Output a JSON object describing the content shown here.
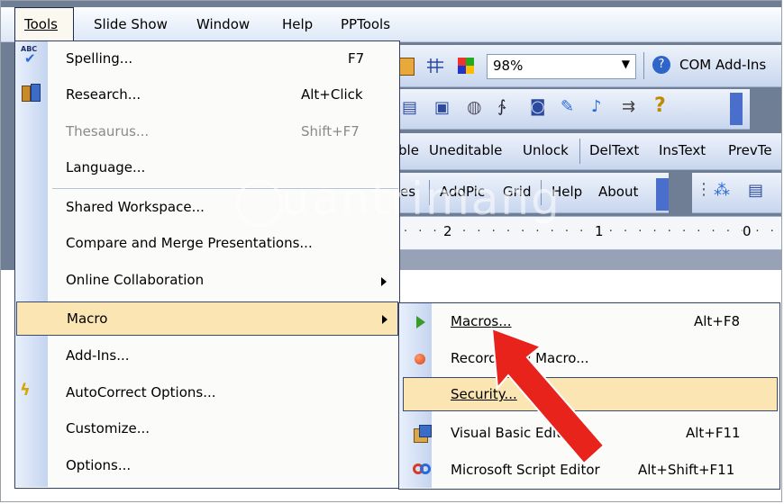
{
  "menubar": {
    "items": [
      {
        "label": "Tools"
      },
      {
        "label": "Slide Show"
      },
      {
        "label": "Window"
      },
      {
        "label": "Help"
      },
      {
        "label": "PPTools"
      }
    ]
  },
  "toolbar1": {
    "zoom": "98%",
    "com_addins": "COM Add-Ins"
  },
  "toolbar3": {
    "items": [
      "ble",
      "Uneditable",
      "Unlock",
      "DelText",
      "InsText",
      "PrevTe"
    ]
  },
  "toolbar4": {
    "items": [
      "es",
      "AddPic",
      "Grid",
      "Help",
      "About"
    ]
  },
  "ruler": {
    "marks": [
      "2",
      "1",
      "0"
    ]
  },
  "watermark": "uantrimang",
  "tools_menu": {
    "items": [
      {
        "label": "Spelling...",
        "shortcut": "F7",
        "icon": "spelling-abc-icon"
      },
      {
        "label": "Research...",
        "shortcut": "Alt+Click",
        "icon": "research-icon"
      },
      {
        "label": "Thesaurus...",
        "shortcut": "Shift+F7",
        "disabled": true
      },
      {
        "label": "Language..."
      },
      {
        "label": "Shared Workspace..."
      },
      {
        "label": "Compare and Merge Presentations..."
      },
      {
        "label": "Online Collaboration",
        "submenu": true
      },
      {
        "label": "Macro",
        "submenu": true,
        "highlighted": true
      },
      {
        "label": "Add-Ins..."
      },
      {
        "label": "AutoCorrect Options...",
        "icon": "lightning-icon"
      },
      {
        "label": "Customize..."
      },
      {
        "label": "Options..."
      }
    ]
  },
  "macro_submenu": {
    "items": [
      {
        "label": "Macros...",
        "shortcut": "Alt+F8",
        "icon": "play-triangle-icon"
      },
      {
        "label": "Record New Macro...",
        "icon": "record-dot-icon"
      },
      {
        "label": "Security...",
        "highlighted": true
      },
      {
        "label": "Visual Basic Editor",
        "shortcut": "Alt+F11",
        "icon": "vb-editor-icon"
      },
      {
        "label": "Microsoft Script Editor",
        "shortcut": "Alt+Shift+F11",
        "icon": "script-editor-icon"
      }
    ]
  },
  "colors": {
    "highlight": "#fbe6b3",
    "arrow": "#e8231c",
    "menu_border": "#334166"
  }
}
